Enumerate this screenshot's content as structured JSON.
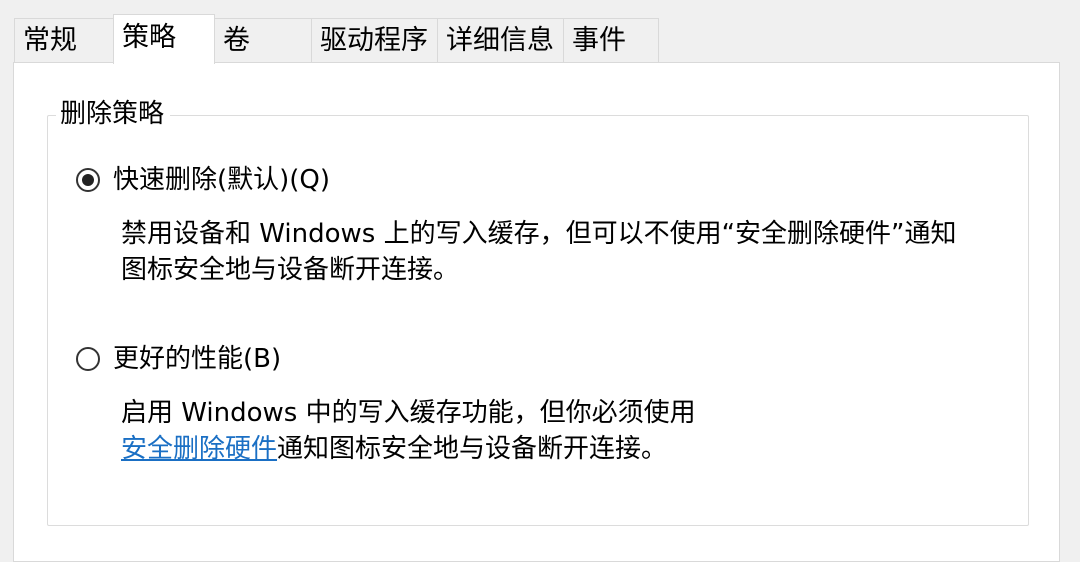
{
  "tabs": [
    {
      "label": "常规",
      "active": false
    },
    {
      "label": "策略",
      "active": true
    },
    {
      "label": "卷",
      "active": false
    },
    {
      "label": "驱动程序",
      "active": false
    },
    {
      "label": "详细信息",
      "active": false
    },
    {
      "label": "事件",
      "active": false
    }
  ],
  "removal_policy": {
    "title": "删除策略",
    "quick_removal": {
      "label": "快速删除(默认)(Q)",
      "selected": true,
      "description_line1": "禁用设备和 Windows 上的写入缓存，但可以不使用“安全删除硬件”通知",
      "description_line2": "图标安全地与设备断开连接。"
    },
    "better_performance": {
      "label": "更好的性能(B)",
      "selected": false,
      "description_line1": "启用 Windows 中的写入缓存功能，但你必须使用",
      "link_text": "安全删除硬件",
      "description_line2_rest": "通知图标安全地与设备断开连接。"
    }
  },
  "colors": {
    "link": "#1a6fc4",
    "window_background": "#f0f0f0",
    "panel_background": "#ffffff"
  }
}
